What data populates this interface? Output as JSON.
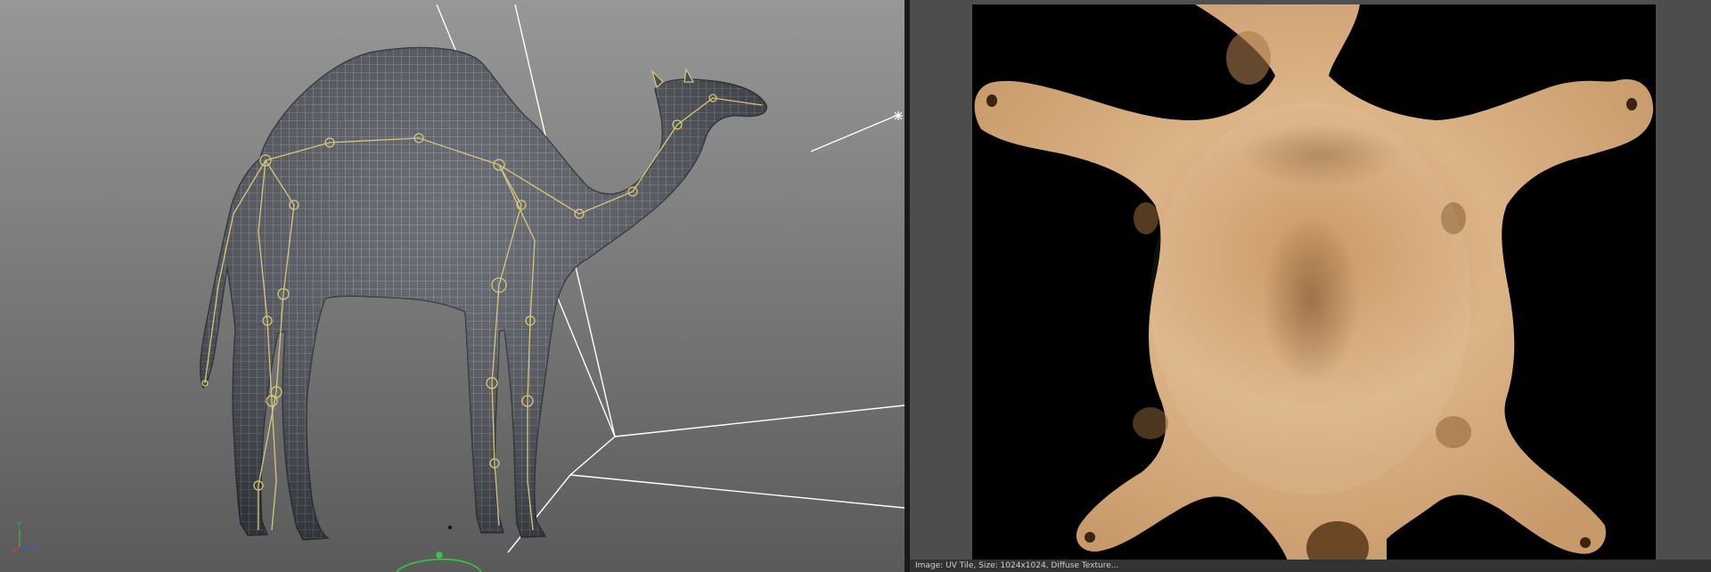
{
  "viewport": {
    "name": "3d-perspective-viewport",
    "axis_gizmo": {
      "y_label": "Y",
      "z_label": "Z",
      "x_color": "#d23a3a",
      "y_color": "#3aa64a",
      "z_color": "#3a5fd2"
    },
    "mesh_color": "#4a4f57",
    "wire_color": "#c9ccd1",
    "bone_color": "#d8c77a",
    "grid_line_color": "#ffffff",
    "manipulator_color": "#2ecc40"
  },
  "uv_editor": {
    "name": "uv-texture-editor",
    "texture_colors": {
      "fur_light": "#d9b085",
      "fur_mid": "#c28f5c",
      "fur_dark": "#8c6238"
    },
    "status_text": "Image: UV Tile, Size: 1024x1024, Diffuse Texture..."
  }
}
